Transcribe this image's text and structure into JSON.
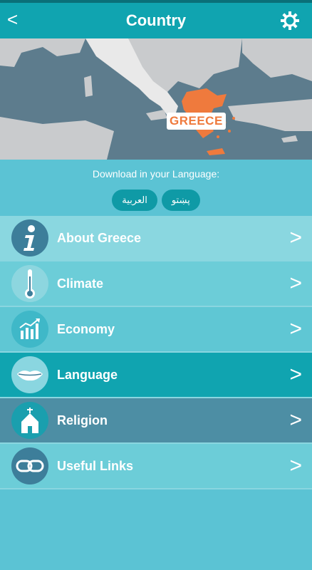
{
  "header": {
    "back": "<",
    "title": "Country"
  },
  "map": {
    "country_label": "GREECE"
  },
  "download": {
    "title": "Download in your Language:",
    "languages": [
      "العربية",
      "پښتو"
    ]
  },
  "menu": [
    {
      "label": "About Greece",
      "icon": "info-icon",
      "bg": "#8ad7e0",
      "circle": "#3d7e9a"
    },
    {
      "label": "Climate",
      "icon": "thermometer-icon",
      "bg": "#6ccdd8",
      "circle": "#8dd6df"
    },
    {
      "label": "Economy",
      "icon": "chart-growth-icon",
      "bg": "#5fc7d4",
      "circle": "#3fb8c8"
    },
    {
      "label": "Language",
      "icon": "lips-icon",
      "bg": "#10a4b0",
      "circle": "#8ad6e0"
    },
    {
      "label": "Religion",
      "icon": "church-icon",
      "bg": "#4d8ea4",
      "circle": "#1a9fae"
    },
    {
      "label": "Useful Links",
      "icon": "link-icon",
      "bg": "#6ccdd8",
      "circle": "#3d7e9a"
    }
  ],
  "chevron": ">"
}
